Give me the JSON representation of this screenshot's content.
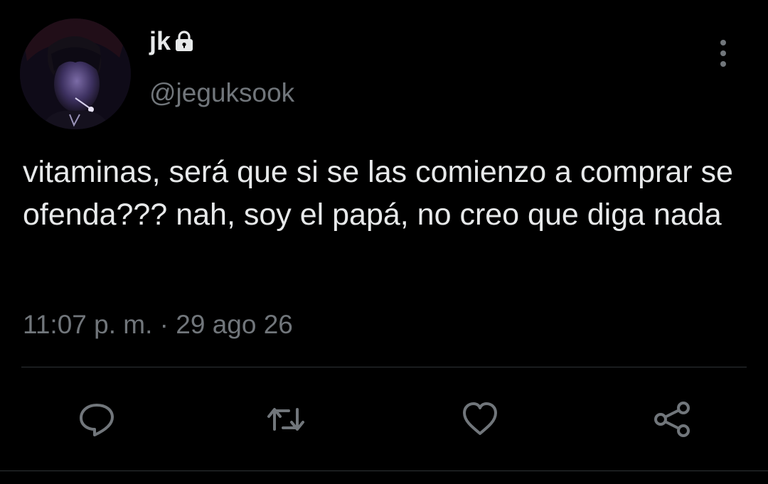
{
  "tweet": {
    "display_name": "jk",
    "handle": "@jeguksook",
    "text": "vitaminas, será que si se las comienzo a comprar se ofenda??? nah, soy el papá, no creo que diga nada",
    "time": "11:07 p. m.",
    "separator": "·",
    "date": "29 ago 26"
  },
  "icons": {
    "lock": "lock-icon",
    "more": "more-vertical-icon",
    "reply": "reply-icon",
    "retweet": "retweet-icon",
    "like": "heart-icon",
    "share": "share-icon"
  },
  "colors": {
    "background": "#000000",
    "primary_text": "#e7e9ea",
    "secondary_text": "#71767b",
    "divider": "#2f3336"
  }
}
